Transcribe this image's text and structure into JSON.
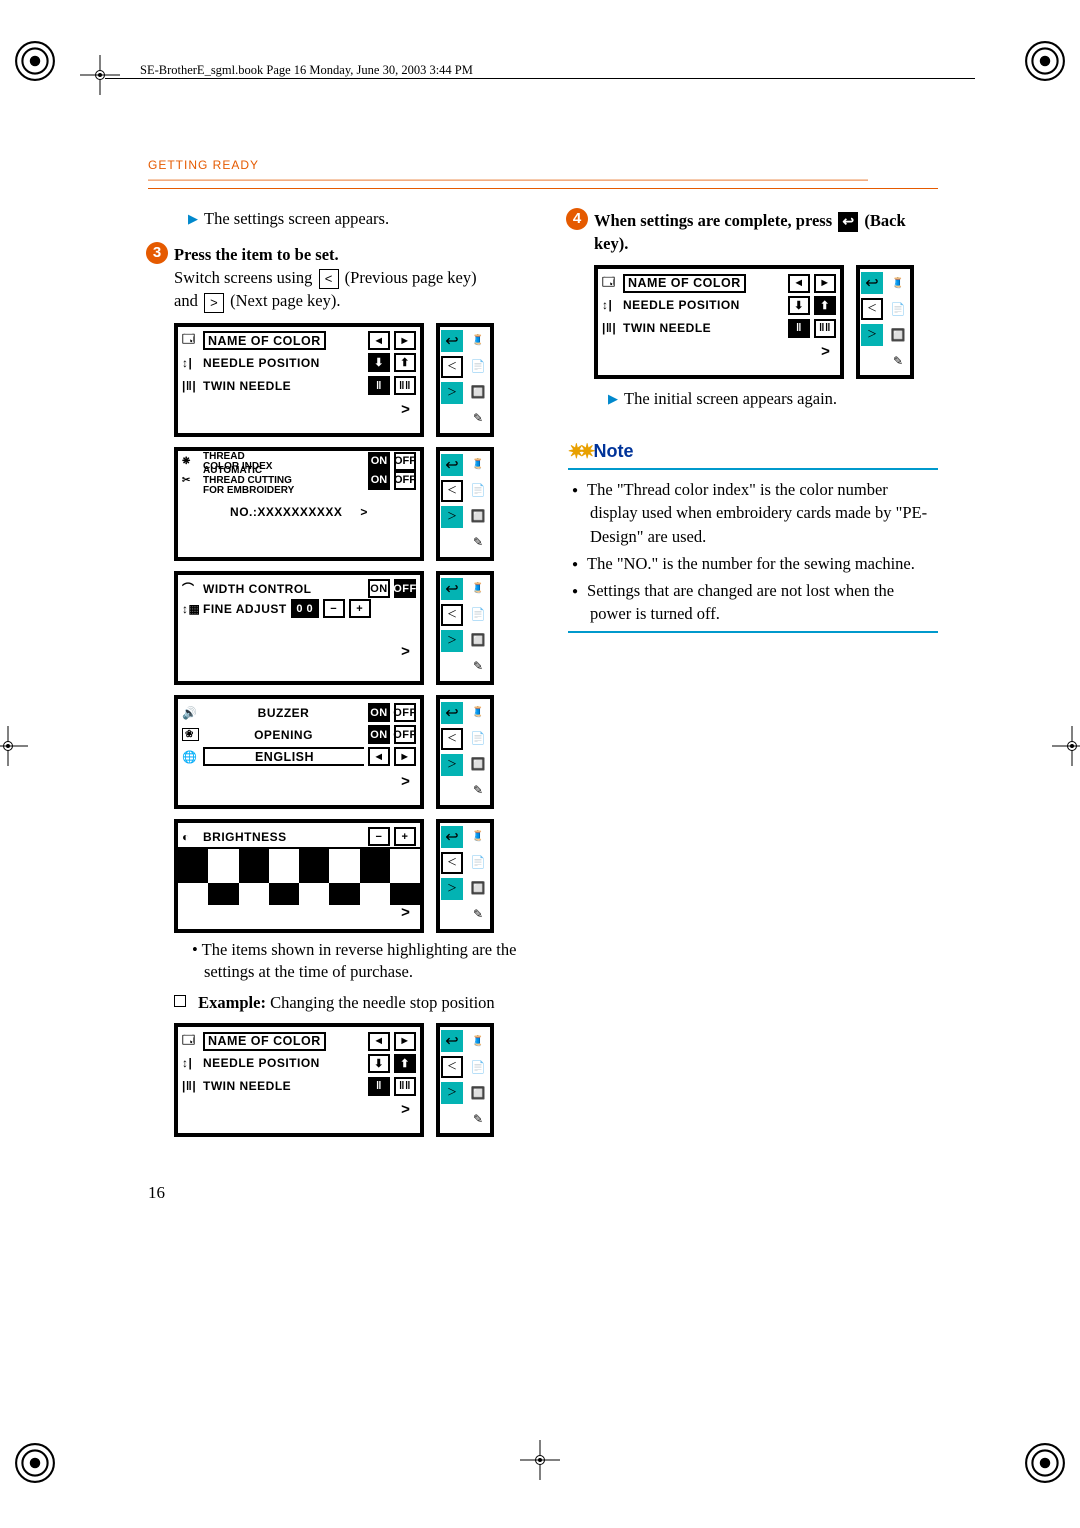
{
  "doc_header": "SE-BrotherE_sgml.book  Page 16  Monday, June 30, 2003  3:44 PM",
  "section_header": "GETTING READY",
  "intro_result": "The settings screen appears.",
  "step3": {
    "num": "3",
    "title": "Press the item to be set.",
    "line2a": "Switch screens using ",
    "line2b": " (Previous page key) ",
    "line3a": "and ",
    "line3b": " (Next page key).",
    "prev_sym": "<",
    "next_sym": ">"
  },
  "lcd_labels": {
    "name_of_color": "NAME OF COLOR",
    "needle_position": "NEEDLE POSITION",
    "twin_needle": "TWIN NEEDLE",
    "thread_color_index_1": "THREAD",
    "thread_color_index_2": "COLOR INDEX",
    "auto_cut_1": "AUTOMATIC",
    "auto_cut_2": "THREAD  CUTTING",
    "auto_cut_3": "FOR EMBROIDERY",
    "no": "NO.:XXXXXXXXXX",
    "width_control": "WIDTH CONTROL",
    "fine_adjust": "FINE ADJUST",
    "buzzer": "BUZZER",
    "opening": "OPENING",
    "english": "ENGLISH",
    "brightness": "BRIGHTNESS",
    "on": "ON",
    "off": "OFF",
    "more": ">",
    "back_icon": "↩",
    "prev_icon": "<",
    "next_icon": ">",
    "minus": "−",
    "plus": "+",
    "arrow_l": "◄",
    "arrow_r": "►",
    "fine_idx": "0 0"
  },
  "after_panels_note": "The items shown in reverse highlighting are the settings at the time of purchase.",
  "example_label": "Example:",
  "example_text": " Changing the needle stop position",
  "step4": {
    "num": "4",
    "title_a": "When settings are complete, press ",
    "title_b": " (Back key).",
    "back_icon": "↩"
  },
  "result_4": "The initial screen appears again.",
  "note": {
    "heading": "Note",
    "items": [
      "The \"Thread color index\" is the color number display used when embroidery cards made by \"PE-Design\" are used.",
      "The \"NO.\" is the number for the sewing machine.",
      "Settings that are changed are not lost when the power is turned off."
    ]
  },
  "page_number": "16"
}
